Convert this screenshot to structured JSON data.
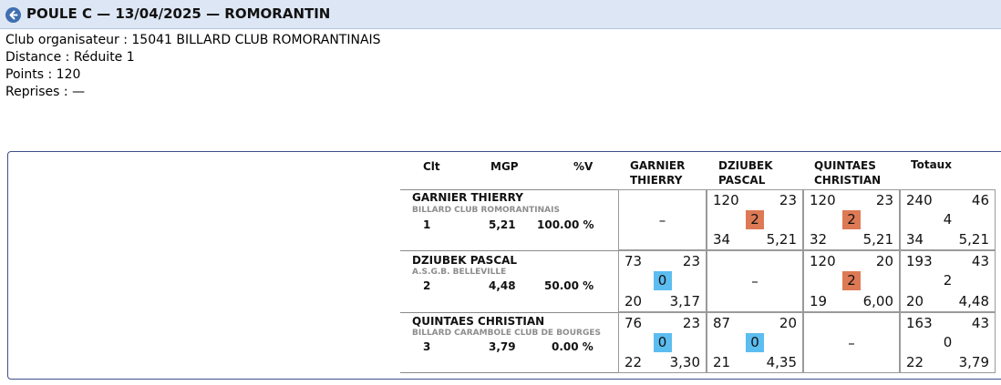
{
  "header": {
    "title": "POULE C — 13/04/2025 — ROMORANTIN"
  },
  "info": {
    "club": "Club organisateur : 15041 BILLARD CLUB ROMORANTINAIS",
    "distance": "Distance : Réduite 1",
    "points": "Points : 120",
    "reprises": "Reprises : —"
  },
  "table": {
    "columns": {
      "clt": "Clt",
      "mgp": "MGP",
      "pctv": "%V",
      "totaux": "Totaux"
    },
    "players": [
      {
        "name": "GARNIER THIERRY",
        "header_line1": "GARNIER",
        "header_line2": "THIERRY",
        "club": "BILLARD CLUB ROMORANTINAIS",
        "clt": "1",
        "mgp": "5,21",
        "pctv": "100.00 %",
        "cells": [
          {
            "dash": "–"
          },
          {
            "points": "120",
            "reprises": "23",
            "result": "2",
            "serie": "34",
            "moyenne": "5,21"
          },
          {
            "points": "120",
            "reprises": "23",
            "result": "2",
            "serie": "32",
            "moyenne": "5,21"
          }
        ],
        "totals": {
          "points": "240",
          "reprises": "46",
          "result": "4",
          "serie": "34",
          "moyenne": "5,21"
        }
      },
      {
        "name": "DZIUBEK PASCAL",
        "header_line1": "DZIUBEK",
        "header_line2": "PASCAL",
        "club": "A.S.G.B. BELLEVILLE",
        "clt": "2",
        "mgp": "4,48",
        "pctv": "50.00 %",
        "cells": [
          {
            "points": "73",
            "reprises": "23",
            "result": "0",
            "serie": "20",
            "moyenne": "3,17"
          },
          {
            "dash": "–"
          },
          {
            "points": "120",
            "reprises": "20",
            "result": "2",
            "serie": "19",
            "moyenne": "6,00"
          }
        ],
        "totals": {
          "points": "193",
          "reprises": "43",
          "result": "2",
          "serie": "20",
          "moyenne": "4,48"
        }
      },
      {
        "name": "QUINTAES CHRISTIAN",
        "header_line1": "QUINTAES",
        "header_line2": "CHRISTIAN",
        "club": "BILLARD CARAMBOLE CLUB DE BOURGES",
        "clt": "3",
        "mgp": "3,79",
        "pctv": "0.00 %",
        "cells": [
          {
            "points": "76",
            "reprises": "23",
            "result": "0",
            "serie": "22",
            "moyenne": "3,30"
          },
          {
            "points": "87",
            "reprises": "20",
            "result": "0",
            "serie": "21",
            "moyenne": "4,35"
          },
          {
            "dash": "–"
          }
        ],
        "totals": {
          "points": "163",
          "reprises": "43",
          "result": "0",
          "serie": "22",
          "moyenne": "3,79"
        }
      }
    ]
  },
  "colors": {
    "win": "#dd7a55",
    "loss": "#5cbdf0",
    "titlebar": "#dde6f4",
    "panel_border": "#3d4f8a"
  }
}
